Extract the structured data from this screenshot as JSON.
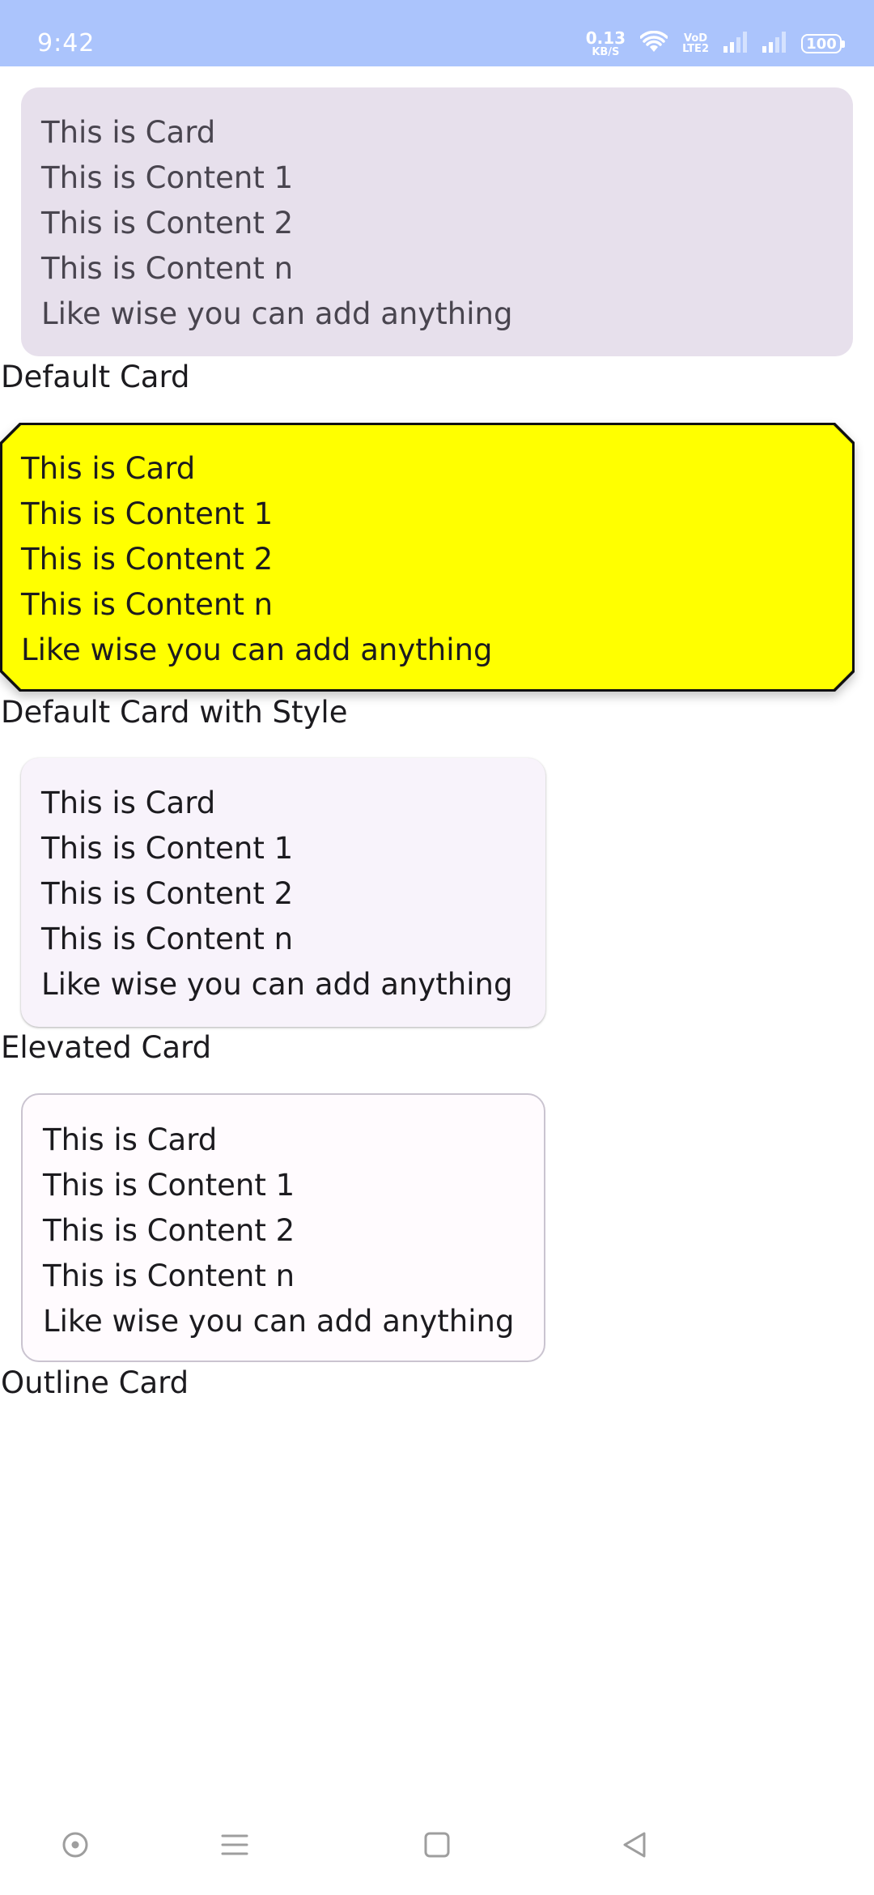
{
  "status_bar": {
    "time": "9:42",
    "net_speed_value": "0.13",
    "net_speed_unit": "KB/S",
    "volte_top": "VoD",
    "volte_bottom": "LTE2",
    "battery": "100",
    "background": "#abc4fc"
  },
  "cards": [
    {
      "lines": [
        "This is Card",
        "This is Content 1",
        "This is Content 2",
        "This is Content n",
        "Like wise you can add anything"
      ],
      "caption": "Default Card",
      "background": "#e7e0ec"
    },
    {
      "lines": [
        "This is Card",
        "This is Content 1",
        "This is Content 2",
        "This is Content n",
        "Like wise you can add anything"
      ],
      "caption": "Default Card with Style",
      "background": "#ffff00"
    },
    {
      "lines": [
        "This is Card",
        "This is Content 1",
        "This is Content 2",
        "This is Content n",
        "Like wise you can add anything"
      ],
      "caption": "Elevated Card",
      "background": "#f8f3fb"
    },
    {
      "lines": [
        "This is Card",
        "This is Content 1",
        "This is Content 2",
        "This is Content n",
        "Like wise you can add anything"
      ],
      "caption": "Outline Card",
      "background": "#fffbfe"
    }
  ],
  "nav_bar": {
    "icons": [
      "assistant-icon",
      "menu-icon",
      "home-icon",
      "back-icon"
    ]
  }
}
